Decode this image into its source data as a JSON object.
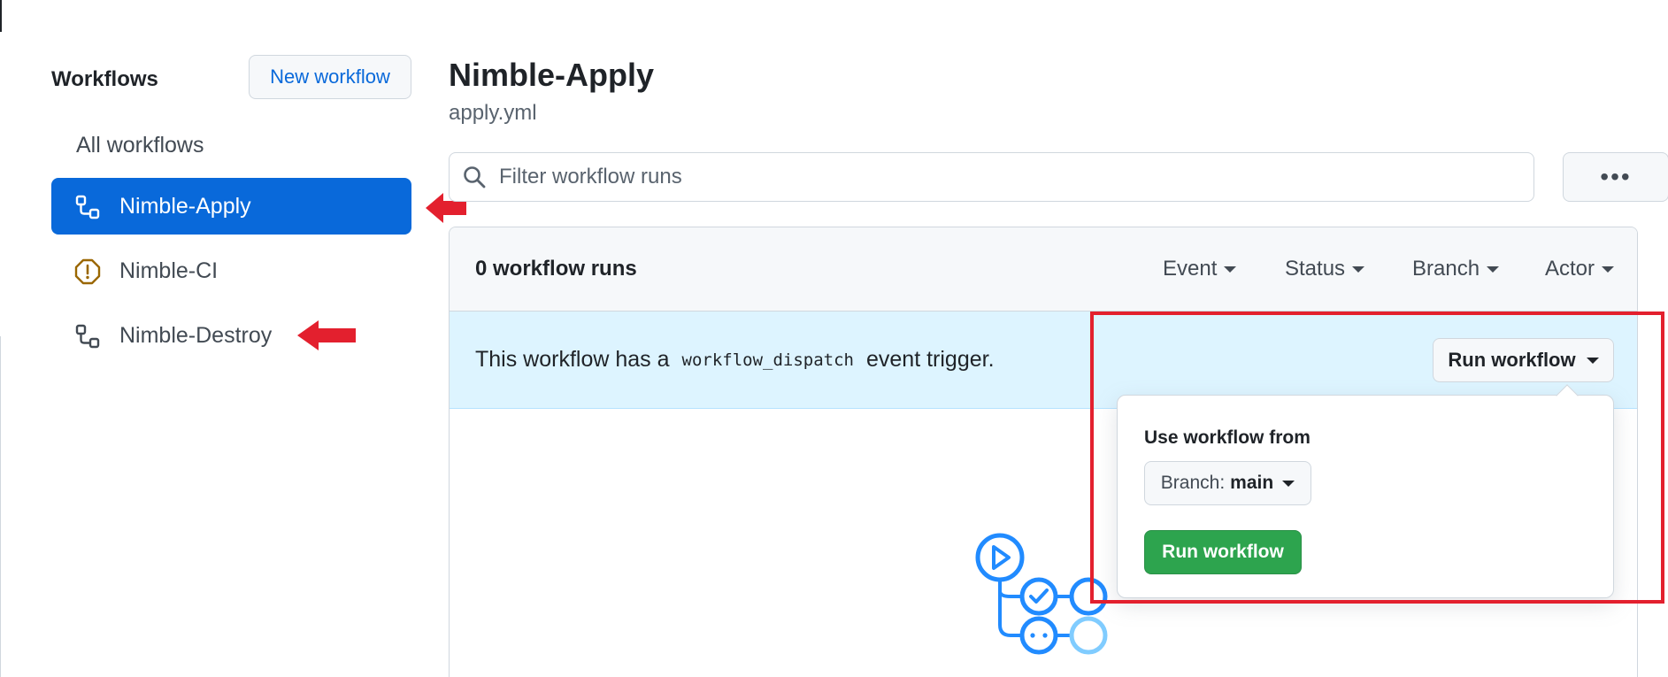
{
  "sidebar": {
    "title": "Workflows",
    "new_workflow_label": "New workflow",
    "items": [
      {
        "label": "All workflows",
        "icon": "none",
        "active": false
      },
      {
        "label": "Nimble-Apply",
        "icon": "workflow-icon",
        "active": true
      },
      {
        "label": "Nimble-CI",
        "icon": "alert-octagon-icon",
        "active": false
      },
      {
        "label": "Nimble-Destroy",
        "icon": "workflow-icon",
        "active": false
      }
    ]
  },
  "header": {
    "title": "Nimble-Apply",
    "subtitle": "apply.yml"
  },
  "filter": {
    "placeholder": "Filter workflow runs"
  },
  "runs": {
    "count_label": "0 workflow runs",
    "filters": [
      "Event",
      "Status",
      "Branch",
      "Actor"
    ]
  },
  "dispatch": {
    "text_before": "This workflow has a",
    "code": "workflow_dispatch",
    "text_after": "event trigger.",
    "run_button_label": "Run workflow"
  },
  "popover": {
    "label": "Use workflow from",
    "branch_prefix": "Branch:",
    "branch_value": "main",
    "run_button_label": "Run workflow"
  },
  "colors": {
    "accent": "#0969da",
    "success": "#2da44e",
    "annotation_red": "#e3202e",
    "banner_bg": "#ddf4ff"
  }
}
